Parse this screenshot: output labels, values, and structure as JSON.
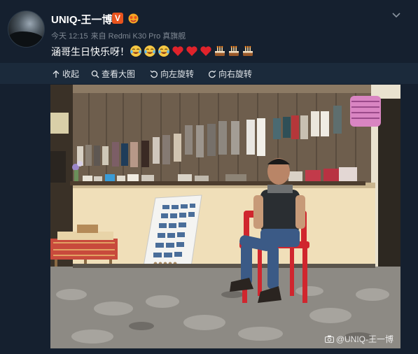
{
  "post": {
    "username": "UNIQ-王一博",
    "vip_badge": "V",
    "time": "今天 12:15",
    "source": "来自 Redmi K30 Pro 真旗舰",
    "text": "涵哥生日快乐呀！",
    "emojis": [
      "laugh-tears",
      "laugh-tears",
      "laugh-tears",
      "red-heart",
      "red-heart",
      "red-heart",
      "birthday-cake",
      "birthday-cake",
      "birthday-cake"
    ]
  },
  "toolbar": {
    "collapse_label": "收起",
    "view_large_label": "查看大图",
    "rotate_left_label": "向左旋转",
    "rotate_right_label": "向右旋转"
  },
  "photo": {
    "watermark": "@UNIQ-王一博"
  },
  "colors": {
    "background": "#15202f",
    "toolbar": "#1b2a3b",
    "meta_text": "#7f8893",
    "badge": "#e8541e"
  }
}
